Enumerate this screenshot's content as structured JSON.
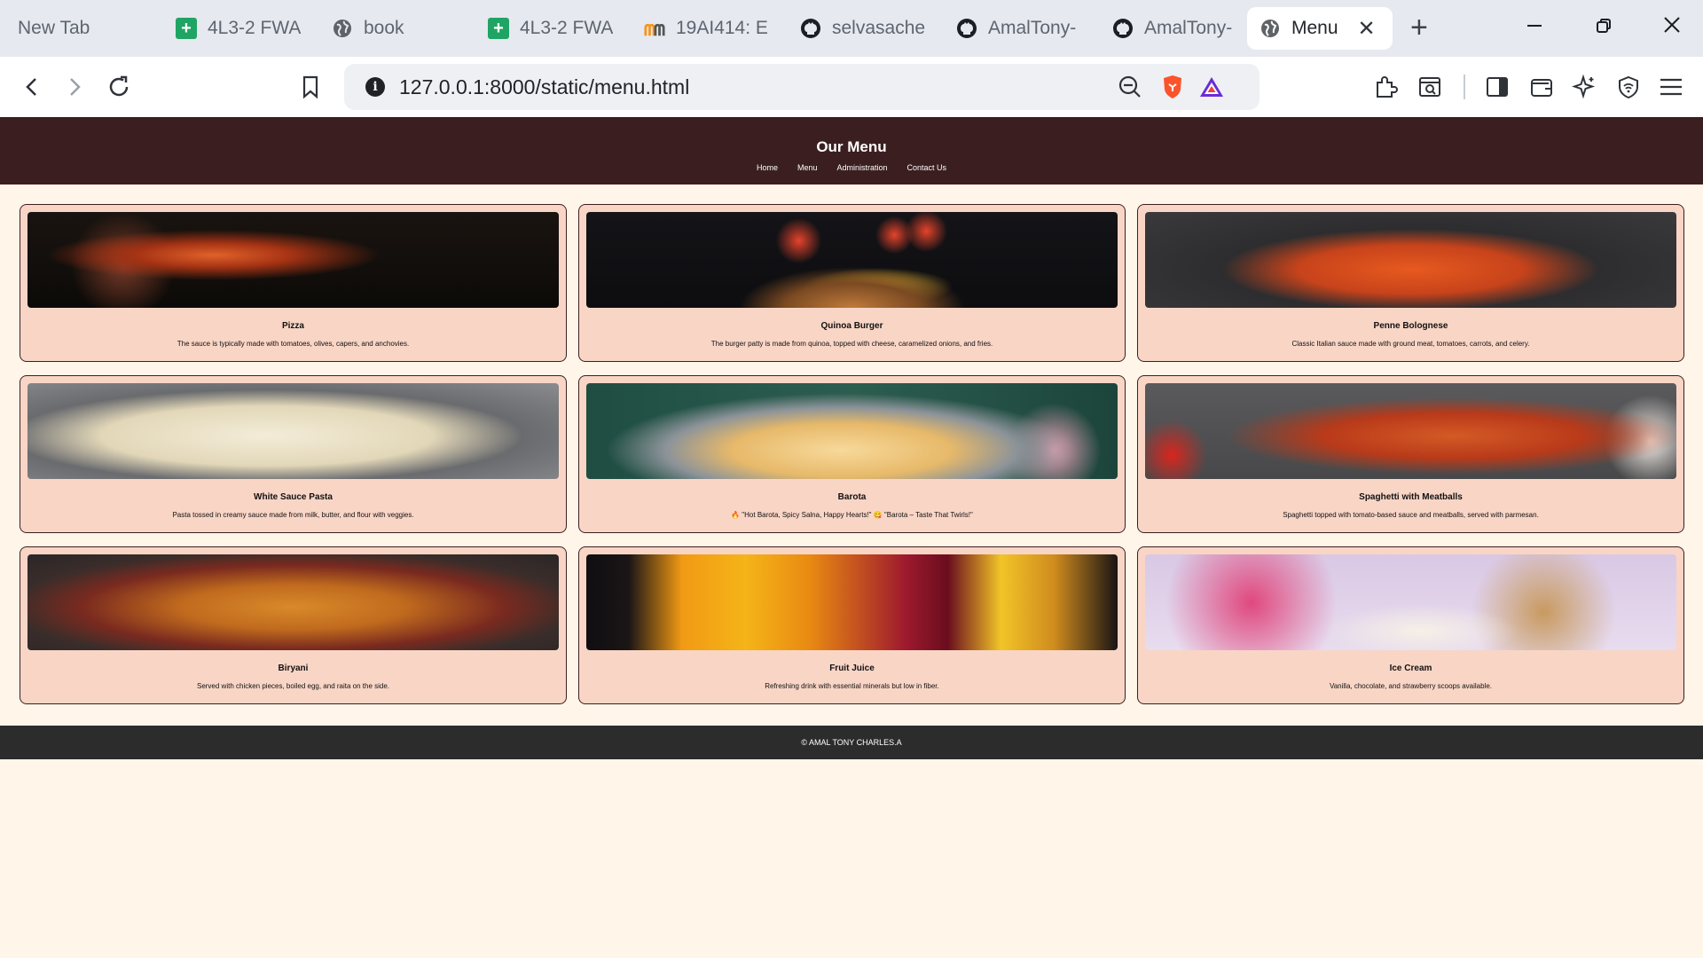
{
  "browser": {
    "tabs": [
      {
        "title": "New Tab",
        "icon": "none"
      },
      {
        "title": "4L3-2 FWA",
        "icon": "google-sheets-icon"
      },
      {
        "title": "book",
        "icon": "globe-icon"
      },
      {
        "title": "4L3-2 FWA",
        "icon": "google-sheets-icon"
      },
      {
        "title": "19AI414: E",
        "icon": "moodle-icon"
      },
      {
        "title": "selvasache",
        "icon": "github-icon"
      },
      {
        "title": "AmalTony-",
        "icon": "github-icon"
      },
      {
        "title": "AmalTony-",
        "icon": "github-icon"
      },
      {
        "title": "Menu",
        "icon": "globe-icon"
      }
    ],
    "url": "127.0.0.1:8000/static/menu.html"
  },
  "header": {
    "title": "Our Menu",
    "nav": [
      "Home",
      "Menu",
      "Administration",
      "Contact Us"
    ]
  },
  "menu": {
    "items": [
      {
        "name": "Pizza",
        "description": "The sauce is typically made with tomatoes, olives, capers, and anchovies."
      },
      {
        "name": "Quinoa Burger",
        "description": "The burger patty is made from quinoa, topped with cheese, caramelized onions, and fries."
      },
      {
        "name": "Penne Bolognese",
        "description": "Classic Italian sauce made with ground meat, tomatoes, carrots, and celery."
      },
      {
        "name": "White Sauce Pasta",
        "description": "Pasta tossed in creamy sauce made from milk, butter, and flour with veggies."
      },
      {
        "name": "Barota",
        "description": "🔥 \"Hot Barota, Spicy Salna, Happy Hearts!\" 😋 \"Barota – Taste That Twirls!\""
      },
      {
        "name": "Spaghetti with Meatballs",
        "description": "Spaghetti topped with tomato-based sauce and meatballs, served with parmesan."
      },
      {
        "name": "Biryani",
        "description": "Served with chicken pieces, boiled egg, and raita on the side."
      },
      {
        "name": "Fruit Juice",
        "description": "Refreshing drink with essential minerals but low in fiber."
      },
      {
        "name": "Ice Cream",
        "description": "Vanilla, chocolate, and strawberry scoops available."
      }
    ]
  },
  "footer": {
    "text": "© AMAL TONY CHARLES.A"
  },
  "colors": {
    "header_bg": "#3b1f20",
    "page_bg": "#fff5e9",
    "card_bg": "#f9d5c6",
    "footer_bg": "#2c2c2c"
  }
}
